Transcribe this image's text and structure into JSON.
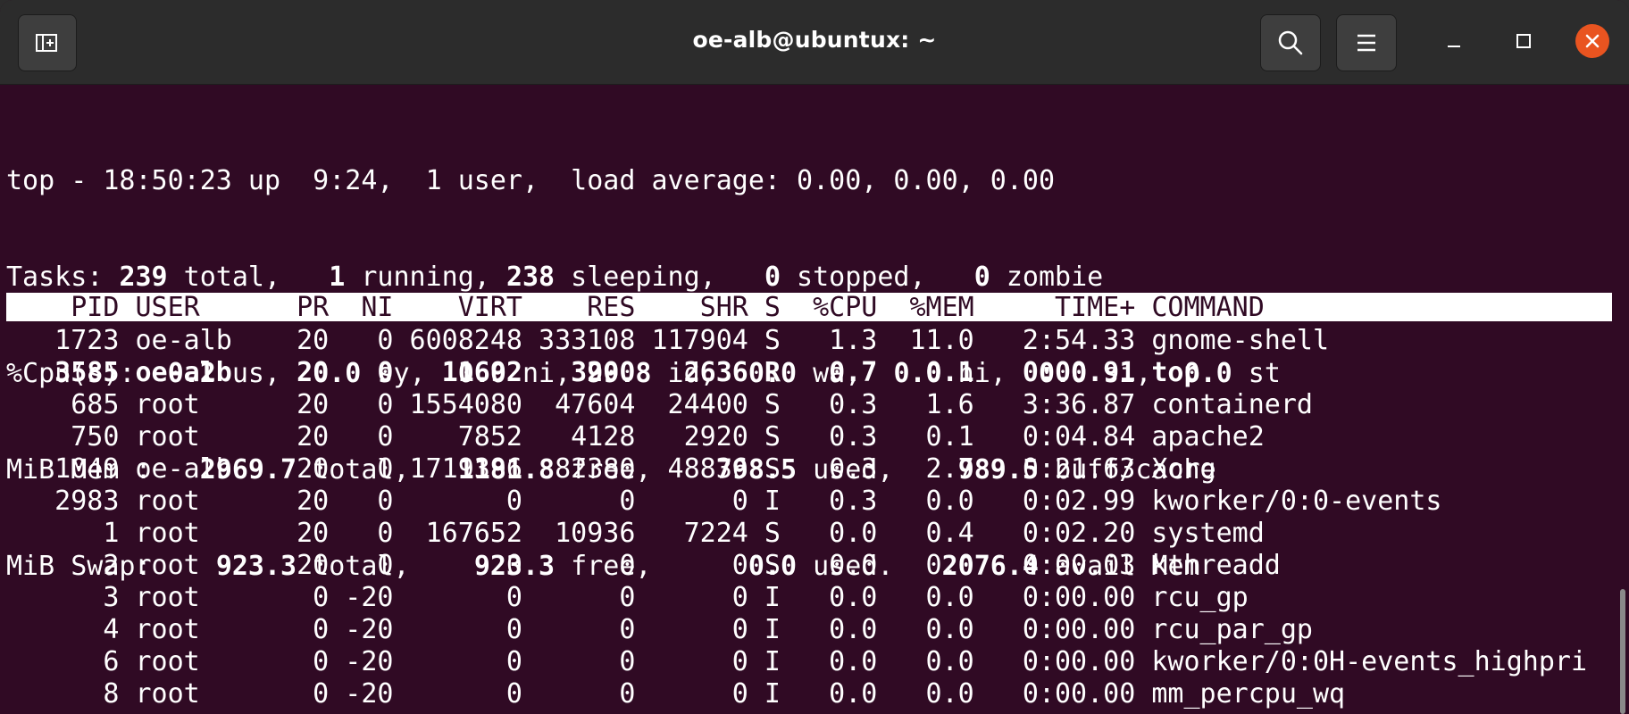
{
  "window": {
    "title": "oe-alb@ubuntux: ~",
    "icons": {
      "new_tab": "new-tab-icon",
      "search": "search-icon",
      "menu": "hamburger-menu-icon",
      "minimize": "minimize-icon",
      "maximize": "maximize-icon",
      "close": "close-icon"
    },
    "colors": {
      "terminal_bg": "#300a24",
      "titlebar_bg": "#2c2c2c",
      "close_accent": "#e95420"
    }
  },
  "summary": {
    "line1": {
      "prefix": "top - 18:50:23 up  9:24,  1 user,  load average: 0.00, 0.00, 0.00"
    },
    "tasks": {
      "label": "Tasks: ",
      "total": "239",
      "total_suffix": " total,   ",
      "running": "1",
      "running_suffix": " running, ",
      "sleeping": "238",
      "sleeping_suffix": " sleeping,   ",
      "stopped": "0",
      "stopped_suffix": " stopped,   ",
      "zombie": "0",
      "zombie_suffix": " zombie"
    },
    "cpu": {
      "label": "%Cpu(s):  ",
      "us": "0.2",
      "us_suffix": " us,  ",
      "sy": "0.0",
      "sy_suffix": " sy,  ",
      "ni": "0.0",
      "ni_suffix": " ni, ",
      "id": "99.8",
      "id_suffix": " id,  ",
      "wa": "0.0",
      "wa_suffix": " wa,  ",
      "hi": "0.0",
      "hi_suffix": " hi,  ",
      "si": "0.0",
      "si_suffix": " si,  ",
      "st": "0.0",
      "st_suffix": " st"
    },
    "mem": {
      "label": "MiB Mem :   ",
      "total": "2969.7",
      "total_suffix": " total,   ",
      "free": "1181.8",
      "free_suffix": " free,    ",
      "used": "798.5",
      "used_suffix": " used,    ",
      "buff": "989.5",
      "buff_suffix": " buff/cache"
    },
    "swap": {
      "label": "MiB Swap:    ",
      "total": "923.3",
      "total_suffix": " total,    ",
      "free": "923.3",
      "free_suffix": " free,      ",
      "used": "0.0",
      "used_suffix": " used.   ",
      "avail": "2076.4",
      "avail_suffix": " avail Mem"
    }
  },
  "table": {
    "header": "    PID USER      PR  NI    VIRT    RES    SHR S  %CPU  %MEM     TIME+ COMMAND",
    "rows": [
      {
        "text": "   1723 oe-alb    20   0 6008248 333108 117904 S   1.3  11.0   2:54.33 gnome-shell",
        "bold": false
      },
      {
        "text": "   3585 oe-alb    20   0   11692   3200   2636 R   0.7   0.1   0:00.91 top",
        "bold": true
      },
      {
        "text": "    685 root      20   0 1554080  47604  24400 S   0.3   1.6   3:36.87 containerd",
        "bold": false
      },
      {
        "text": "    750 root      20   0    7852   4128   2920 S   0.3   0.1   0:04.84 apache2",
        "bold": false
      },
      {
        "text": "   1049 oe-alb    20   0 1719396  82380  48836 S   0.3   2.7   0:21.63 Xorg",
        "bold": false
      },
      {
        "text": "   2983 root      20   0       0      0      0 I   0.3   0.0   0:02.99 kworker/0:0-events",
        "bold": false
      },
      {
        "text": "      1 root      20   0  167652  10936   7224 S   0.0   0.4   0:02.20 systemd",
        "bold": false
      },
      {
        "text": "      2 root      20   0       0      0      0 S   0.0   0.0   0:00.03 kthreadd",
        "bold": false
      },
      {
        "text": "      3 root       0 -20       0      0      0 I   0.0   0.0   0:00.00 rcu_gp",
        "bold": false
      },
      {
        "text": "      4 root       0 -20       0      0      0 I   0.0   0.0   0:00.00 rcu_par_gp",
        "bold": false
      },
      {
        "text": "      6 root       0 -20       0      0      0 I   0.0   0.0   0:00.00 kworker/0:0H-events_highpri",
        "bold": false
      },
      {
        "text": "      8 root       0 -20       0      0      0 I   0.0   0.0   0:00.00 mm_percpu_wq",
        "bold": false
      }
    ]
  }
}
